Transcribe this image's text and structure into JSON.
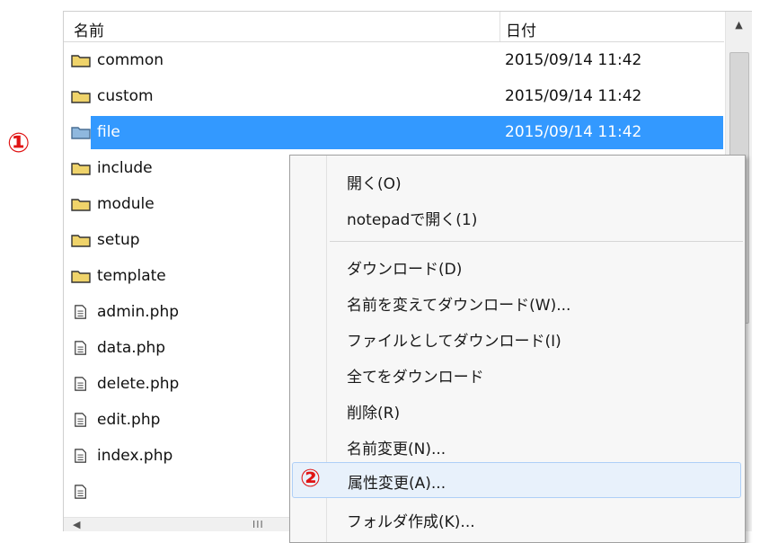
{
  "columns": {
    "name": "名前",
    "date": "日付"
  },
  "files": [
    {
      "name": "common",
      "type": "folder",
      "date": "2015/09/14 11:42"
    },
    {
      "name": "custom",
      "type": "folder",
      "date": "2015/09/14 11:42"
    },
    {
      "name": "file",
      "type": "folder",
      "date": "2015/09/14 11:42",
      "selected": true
    },
    {
      "name": "include",
      "type": "folder",
      "date": ""
    },
    {
      "name": "module",
      "type": "folder",
      "date": ""
    },
    {
      "name": "setup",
      "type": "folder",
      "date": ""
    },
    {
      "name": "template",
      "type": "folder",
      "date": ""
    },
    {
      "name": "admin.php",
      "type": "file",
      "date": ""
    },
    {
      "name": "data.php",
      "type": "file",
      "date": ""
    },
    {
      "name": "delete.php",
      "type": "file",
      "date": ""
    },
    {
      "name": "edit.php",
      "type": "file",
      "date": ""
    },
    {
      "name": "index.php",
      "type": "file",
      "date": ""
    }
  ],
  "context_menu": {
    "items": [
      "開く(O)",
      "notepadで開く(1)",
      "ダウンロード(D)",
      "名前を変えてダウンロード(W)...",
      "ファイルとしてダウンロード(I)",
      "全てをダウンロード",
      "削除(R)",
      "名前変更(N)...",
      "属性変更(A)...",
      "フォルダ作成(K)..."
    ],
    "highlighted": "属性変更(A)..."
  },
  "annotations": {
    "step1": "①",
    "step2": "②"
  },
  "scrollbar": {
    "up_arrow": "▲",
    "left_arrow": "◀",
    "grip": "III"
  },
  "colors": {
    "selection": "#3399ff",
    "marker": "#e01414",
    "folder_fill": "#efd36a",
    "selected_folder_fill": "#8fb8de",
    "menu_hover": "#e8f1fb"
  },
  "icons": {
    "folder": "folder-icon",
    "file": "file-icon"
  }
}
